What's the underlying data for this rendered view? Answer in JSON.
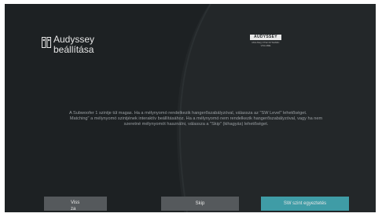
{
  "header": {
    "icon": "speaker-setup-icon",
    "title": "Audyssey beállítása"
  },
  "logo": {
    "name": "AUDYSSEY",
    "tagline": "MULTEQ XT32 DYNAMIC VOLUME"
  },
  "message": {
    "paragraph1": "A Subwoofer 1 szintje túl magas. Ha a mélynyomó rendelkezik hangerőszabályzóval, válassza az \"SW Level\" lehetőséget.",
    "paragraph2": "Matching\" a mélynyomó szintjének interaktív beállításához. Ha a mélynyomó nem rendelkezik hangerőszabályzóval, vagy ha nem szeretné mélynyomót használni, válassza a \"Skip\" (kihagyás) lehetőséget."
  },
  "buttons": {
    "back": "Vissza",
    "skip": "Skip",
    "sw_level": "SW szint egyeztetés"
  },
  "colors": {
    "background": "#1d2123",
    "button": "#55595c",
    "accent": "#3f9ca6",
    "text": "#e6e6e6"
  }
}
